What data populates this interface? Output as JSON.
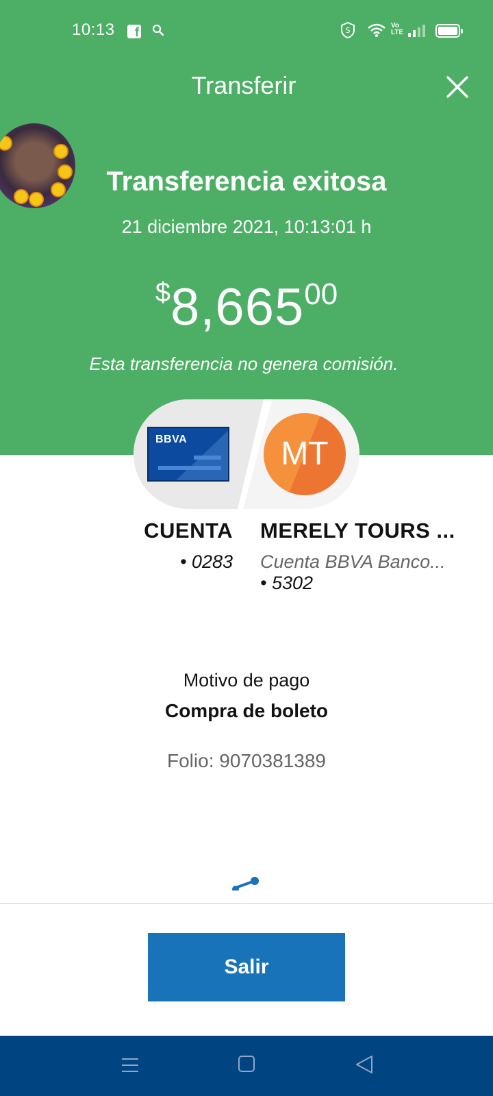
{
  "status_bar": {
    "time": "10:13",
    "fb_glyph": "f"
  },
  "header": {
    "title": "Transferir"
  },
  "result": {
    "title": "Transferencia exitosa",
    "date": "21 diciembre 2021, 10:13:01 h",
    "amount_currency": "$",
    "amount_integer": "8,665",
    "amount_decimals": "00",
    "fee_note": "Esta transferencia no genera comisión."
  },
  "origin": {
    "card_logo": "BBVA",
    "name": "CUENTA",
    "number": "• 0283"
  },
  "destination": {
    "initials": "MT",
    "name": "MERELY TOURS ...",
    "bank": "Cuenta BBVA Banco...",
    "number": "• 5302"
  },
  "payment": {
    "reason_label": "Motivo de pago",
    "reason_value": "Compra de boleto",
    "folio": "Folio: 9070381389"
  },
  "actions": {
    "exit_label": "Salir"
  },
  "colors": {
    "header_green": "#4caf65",
    "button_blue": "#1973b8",
    "nav_blue": "#004481",
    "avatar_orange": "#f5913c"
  }
}
